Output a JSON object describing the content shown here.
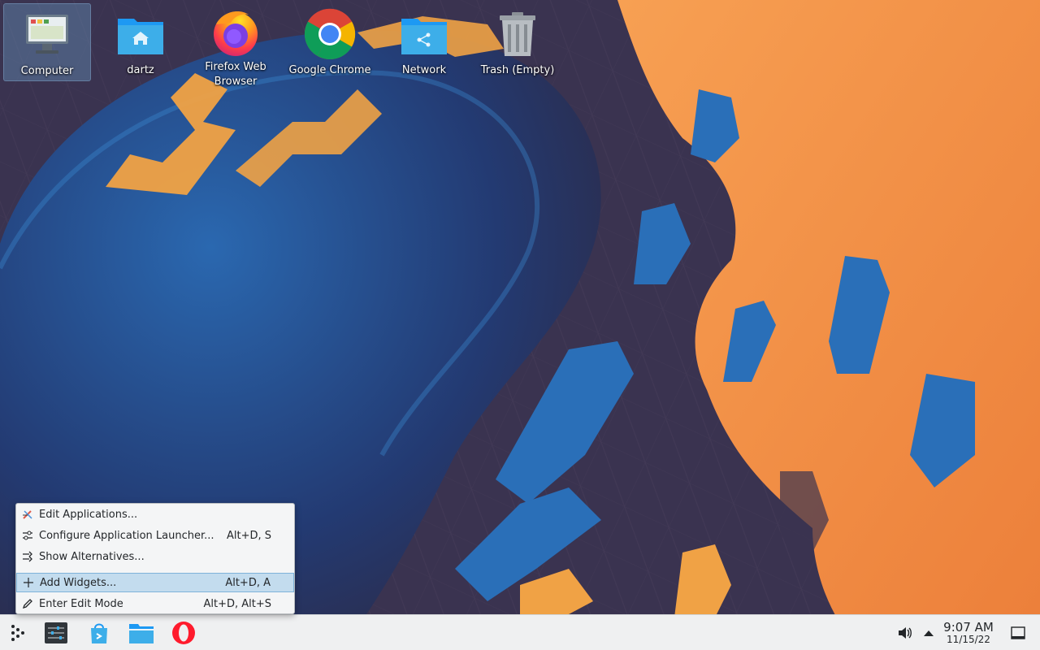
{
  "desktop": {
    "icons": [
      {
        "label": "Computer",
        "icon": "computer-icon",
        "selected": true
      },
      {
        "label": "dartz",
        "icon": "home-folder-icon"
      },
      {
        "label": "Firefox Web Browser",
        "icon": "firefox-icon"
      },
      {
        "label": "Google Chrome",
        "icon": "chrome-icon"
      },
      {
        "label": "Network",
        "icon": "network-folder-icon"
      },
      {
        "label": "Trash (Empty)",
        "icon": "trash-icon"
      }
    ]
  },
  "context_menu": {
    "items": [
      {
        "label": "Edit Applications...",
        "shortcut": "",
        "icon": "edit-applications-icon"
      },
      {
        "label": "Configure Application Launcher...",
        "shortcut": "Alt+D, S",
        "icon": "configure-icon"
      },
      {
        "label": "Show Alternatives...",
        "shortcut": "",
        "icon": "alternatives-icon"
      },
      {
        "label": "Add Widgets...",
        "shortcut": "Alt+D, A",
        "icon": "plus-icon",
        "highlighted": true
      },
      {
        "label": "Enter Edit Mode",
        "shortcut": "Alt+D, Alt+S",
        "icon": "pencil-icon"
      }
    ]
  },
  "taskbar": {
    "launchers": [
      "app-launcher-icon",
      "system-settings-icon",
      "discover-icon",
      "file-manager-icon",
      "opera-icon"
    ],
    "tray": [
      "volume-icon",
      "expand-tray-icon",
      "show-desktop-icon"
    ],
    "clock": {
      "time": "9:07 AM",
      "date": "11/15/22"
    }
  },
  "colors": {
    "accent": "#3daee9",
    "highlight": "#c3dcee",
    "wallpaper_orange": "#f08a3e",
    "wallpaper_blue": "#1e5aa0"
  }
}
